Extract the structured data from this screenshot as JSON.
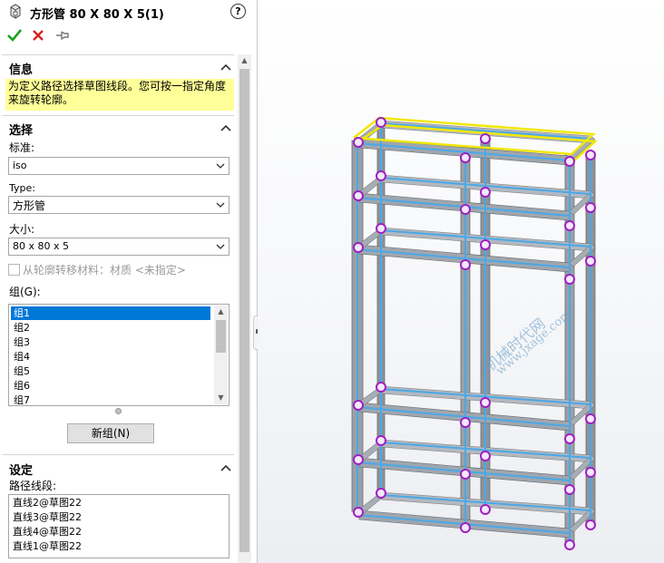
{
  "header": {
    "title": "方形管 80 X 80 X 5(1)",
    "help": "?"
  },
  "actions": {
    "ok": "ok-check",
    "cancel": "cancel-x",
    "pin": "pushpin"
  },
  "info": {
    "title": "信息",
    "message": "为定义路径选择草图线段。您可按一指定角度来旋转轮廓。"
  },
  "selection": {
    "title": "选择",
    "standard_label": "标准:",
    "standard_value": "iso",
    "type_label": "Type:",
    "type_value": "方形管",
    "size_label": "大小:",
    "size_value": "80 x 80 x 5",
    "transfer_label": "从轮廓转移材料：材质 <未指定>",
    "group_label": "组(G):",
    "groups": [
      "组1",
      "组2",
      "组3",
      "组4",
      "组5",
      "组6",
      "组7"
    ],
    "selected_group": "组1",
    "new_group_button": "新组(N)"
  },
  "settings": {
    "title": "设定",
    "path_label": "路径线段:",
    "path_segments": [
      "直线2@草图22",
      "直线3@草图22",
      "直线4@草图22",
      "直线1@草图22"
    ]
  },
  "watermark": {
    "line1": "机械时代网",
    "line2": "www.jxage.com"
  },
  "colors": {
    "accent": "#0078d7",
    "info_bg": "#ffff99",
    "ok": "#1aa01a",
    "cancel": "#e02020",
    "frame_blue": "#4aa8e8",
    "frame_yellow": "#f0e800",
    "node_purple": "#a020c0"
  }
}
